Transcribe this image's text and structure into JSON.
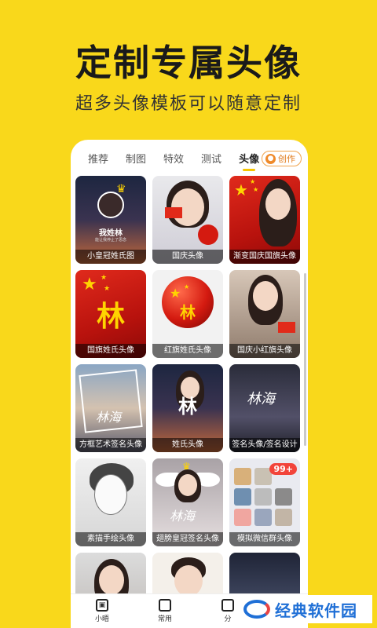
{
  "promo": {
    "title": "定制专属头像",
    "subtitle": "超多头像模板可以随意定制"
  },
  "tabs": [
    {
      "label": "推荐",
      "active": false
    },
    {
      "label": "制图",
      "active": false
    },
    {
      "label": "特效",
      "active": false
    },
    {
      "label": "测试",
      "active": false
    },
    {
      "label": "头像",
      "active": true
    }
  ],
  "create_button": {
    "label": "创作",
    "icon": "bulb-icon"
  },
  "cards": [
    {
      "label": "小皇冠姓氏图",
      "art_text": "我姓林",
      "art_subtext": "能让我停止了思念"
    },
    {
      "label": "国庆头像"
    },
    {
      "label": "渐变国庆国旗头像"
    },
    {
      "label": "国旗姓氏头像",
      "art_text": "林"
    },
    {
      "label": "红旗姓氏头像",
      "art_text": "林"
    },
    {
      "label": "国庆小红旗头像"
    },
    {
      "label": "方框艺术签名头像",
      "art_text": "林海"
    },
    {
      "label": "姓氏头像",
      "art_text": "林"
    },
    {
      "label": "签名头像/签名设计",
      "art_text": "林海"
    },
    {
      "label": "素描手绘头像"
    },
    {
      "label": "翅膀皇冠签名头像",
      "art_text": "林海"
    },
    {
      "label": "模拟微信群头像",
      "badge": "99+"
    },
    {
      "label": ""
    },
    {
      "label": ""
    },
    {
      "label": ""
    }
  ],
  "bottom_nav": [
    {
      "label": "小晤",
      "icon": "box-icon"
    },
    {
      "label": "常用",
      "icon": "toolbox-icon"
    },
    {
      "label": "分",
      "icon": "share-icon"
    }
  ],
  "watermark": {
    "text": "经典软件园"
  },
  "colors": {
    "background": "#f9d81b",
    "accent": "#f5c500",
    "create": "#e07a1a"
  }
}
